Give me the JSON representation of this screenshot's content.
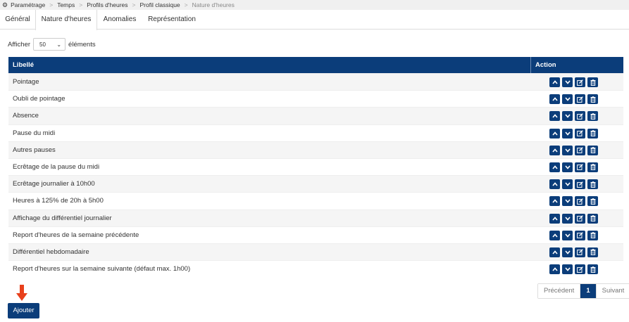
{
  "breadcrumb": {
    "items": [
      "Paramétrage",
      "Temps",
      "Profils d'heures",
      "Profil classique",
      "Nature d'heures"
    ]
  },
  "tabs": [
    "Général",
    "Nature d'heures",
    "Anomalies",
    "Représentation"
  ],
  "active_tab": "Nature d'heures",
  "length_menu": {
    "prefix": "Afficher",
    "value": "50",
    "suffix": "éléments"
  },
  "table": {
    "headers": {
      "label": "Libellé",
      "action": "Action"
    },
    "rows": [
      "Pointage",
      "Oubli de pointage",
      "Absence",
      "Pause du midi",
      "Autres pauses",
      "Ecrêtage de la pause du midi",
      "Ecrêtage journalier à 10h00",
      "Heures à 125% de 20h à 5h00",
      "Affichage du différentiel journalier",
      "Report d'heures de la semaine précédente",
      "Différentiel hebdomadaire",
      "Report d'heures sur la semaine suivante (défaut max. 1h00)"
    ],
    "row_action_icons": [
      "chevron-up-icon",
      "chevron-down-icon",
      "edit-icon",
      "trash-icon"
    ]
  },
  "pagination": {
    "previous": "Précédent",
    "current": "1",
    "next": "Suivant"
  },
  "add_button": "Ajouter",
  "colors": {
    "primary": "#0b3d7a",
    "arrow": "#e8401c"
  }
}
